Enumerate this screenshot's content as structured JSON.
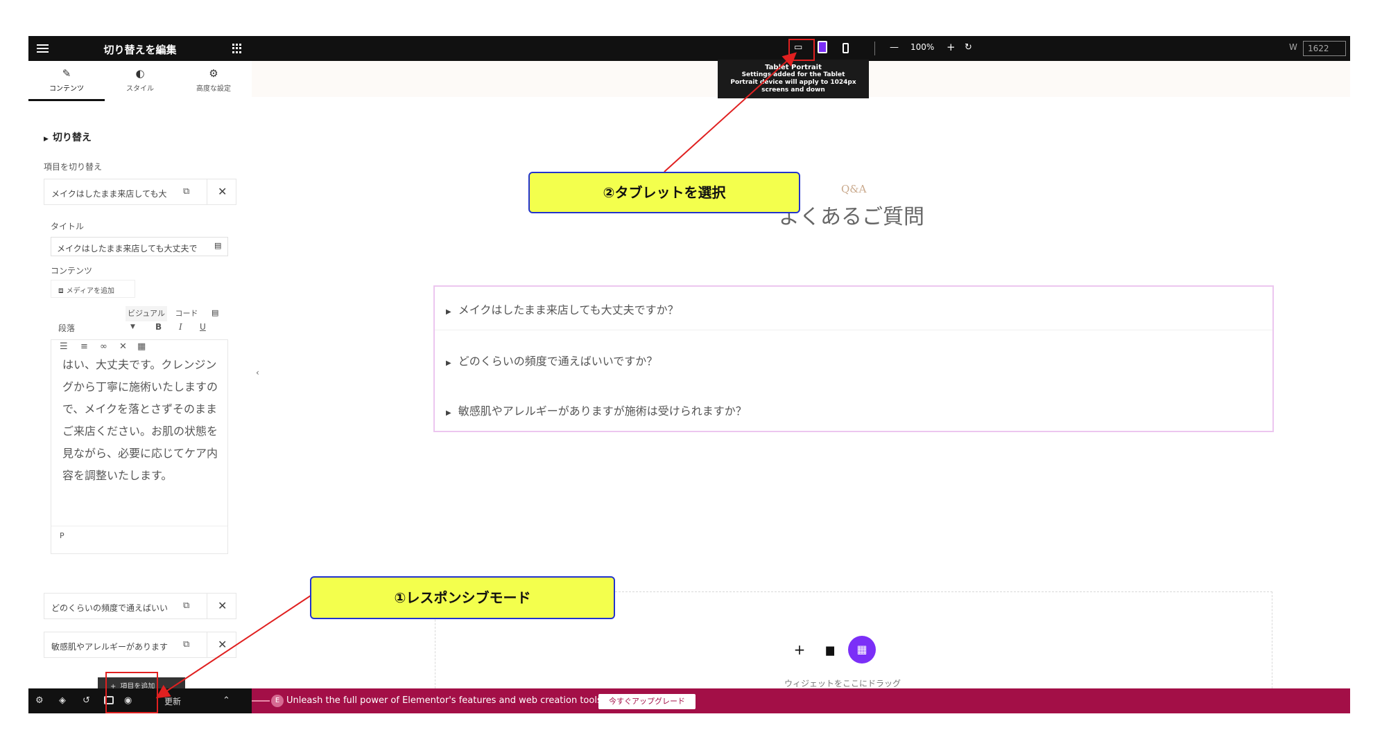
{
  "panel": {
    "header_title": "切り替えを編集",
    "tabs": [
      {
        "label": "コンテンツ",
        "icon": "pencil-icon"
      },
      {
        "label": "スタイル",
        "icon": "contrast-icon"
      },
      {
        "label": "高度な設定",
        "icon": "gear-icon"
      }
    ],
    "section_title": "切り替え",
    "items_label": "項目を切り替え",
    "items": [
      {
        "title": "メイクはしたまま来店しても大"
      },
      {
        "title": "どのくらいの頻度で通えばいい"
      },
      {
        "title": "敏感肌やアレルギーがあります"
      }
    ],
    "title_label": "タイトル",
    "title_value": "メイクはしたまま来店しても大丈夫で",
    "content_label": "コンテンツ",
    "add_media": "メディアを追加",
    "editor_tabs": {
      "visual": "ビジュアル",
      "code": "コード"
    },
    "format_select": "段落",
    "bold": "B",
    "italic": "I",
    "underline": "U",
    "editor_content": "はい、大丈夫です。クレンジングから丁寧に施術いたしますので、メイクを落とさずそのままご来店ください。お肌の状態を見ながら、必要に応じてケア内容を調整いたします。",
    "editor_path": "P",
    "add_item": "項目を追加"
  },
  "topbar": {
    "zoom": "100%",
    "width_label": "W",
    "width_value": "1622"
  },
  "tooltip": {
    "title": "Tablet Portrait",
    "description": "Settings added for the Tablet Portrait device will apply to 1024px screens and down"
  },
  "canvas": {
    "qa_small": "Q&A",
    "qa_title": "よくあるご質問",
    "faq_items": [
      "メイクはしたまま来店しても大丈夫ですか？",
      "どのくらいの頻度で通えばいいですか？",
      "敏感肌やアレルギーがありますが施術は受けられますか？"
    ],
    "drop_hint": "ウィジェットをここにドラッグ"
  },
  "bottombar": {
    "update_label": "更新"
  },
  "promo": {
    "text": "Unleash the full power of Elementor's features and web creation tools.",
    "button": "今すぐアップグレード"
  },
  "callouts": {
    "responsive": "①レスポンシブモード",
    "tablet": "②タブレットを選択"
  },
  "colors": {
    "dark_bar": "#111111",
    "promo_bg": "#a30f47",
    "accent_purple": "#7b2ff7",
    "callout_bg": "#f3ff4d",
    "annotation_red": "#e02020"
  }
}
